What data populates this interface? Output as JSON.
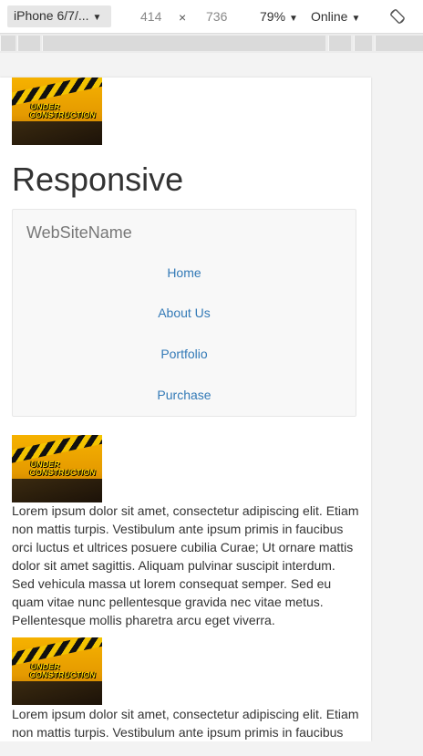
{
  "devtools": {
    "device": "iPhone 6/7/...",
    "width": "414",
    "times": "×",
    "height": "736",
    "zoom": "79%",
    "throttle": "Online",
    "caret": "▼"
  },
  "page": {
    "logo_text_line1": "UNDER",
    "logo_text_line2": "CONSTRUCTION",
    "title": "Responsive",
    "navbar": {
      "brand": "WebSiteName",
      "links": [
        "Home",
        "About Us",
        "Portfolio",
        "Purchase"
      ]
    },
    "articles": [
      {
        "text": "Lorem ipsum dolor sit amet, consectetur adipiscing elit. Etiam non mattis turpis. Vestibulum ante ipsum primis in faucibus orci luctus et ultrices posuere cubilia Curae; Ut ornare mattis dolor sit amet sagittis. Aliquam pulvinar suscipit interdum. Sed vehicula massa ut lorem consequat semper. Sed eu quam vitae nunc pellentesque gravida nec vitae metus. Pellentesque mollis pharetra arcu eget viverra."
      },
      {
        "text": "Lorem ipsum dolor sit amet, consectetur adipiscing elit. Etiam non mattis turpis. Vestibulum ante ipsum primis in faucibus"
      }
    ]
  }
}
